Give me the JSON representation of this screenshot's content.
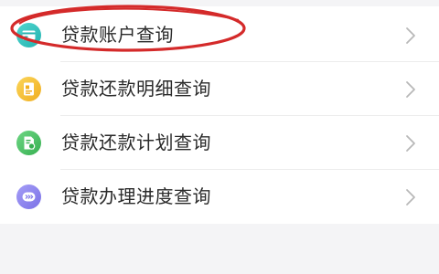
{
  "menu": {
    "items": [
      {
        "label": "贷款账户查询",
        "icon": "loan-account-card-icon",
        "icon_color": "#33c5c0"
      },
      {
        "label": "贷款还款明细查询",
        "icon": "repayment-detail-icon",
        "icon_color": "#f5c23a"
      },
      {
        "label": "贷款还款计划查询",
        "icon": "repayment-plan-icon",
        "icon_color": "#53c46b"
      },
      {
        "label": "贷款办理进度查询",
        "icon": "progress-icon",
        "icon_color": "#8e86f0"
      }
    ]
  },
  "annotation": {
    "highlight_color": "#d42a2a",
    "highlighted_item": "贷款账户查询"
  },
  "colors": {
    "background": "#f4f4f6",
    "card": "#ffffff",
    "text": "#2a2a2a",
    "chevron": "#b8b8b8"
  }
}
